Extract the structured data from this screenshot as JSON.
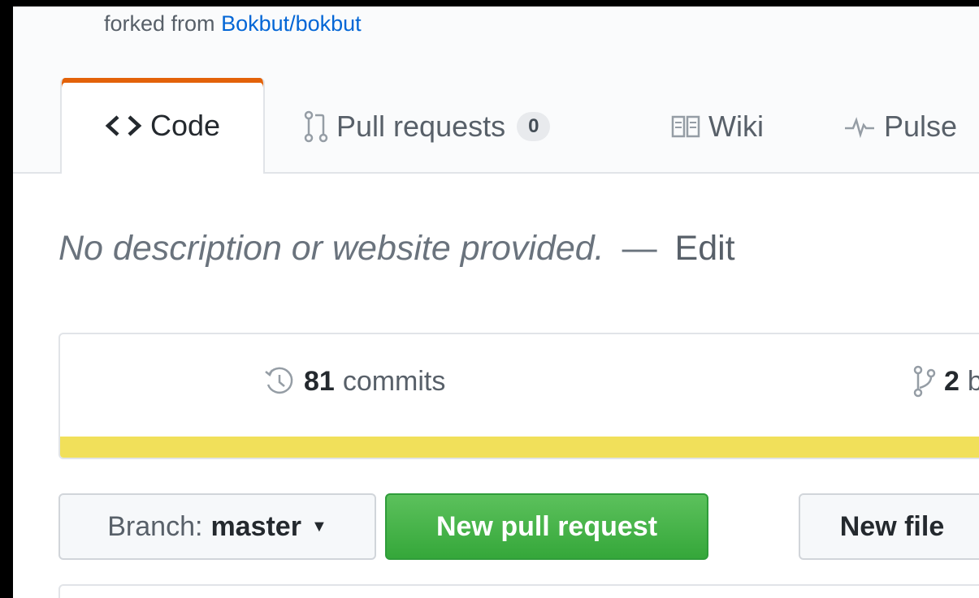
{
  "repo": {
    "fork_prefix": "forked from",
    "fork_source": "Bokbut/bokbut"
  },
  "tabs": [
    {
      "label": "Code",
      "icon": "code-icon",
      "selected": true
    },
    {
      "label": "Pull requests",
      "icon": "pull-request-icon",
      "count": "0"
    },
    {
      "label": "Wiki",
      "icon": "book-icon"
    },
    {
      "label": "Pulse",
      "icon": "pulse-icon"
    }
  ],
  "description": {
    "text": "No description or website provided.",
    "dash": "—",
    "edit_label": "Edit"
  },
  "summary": {
    "commits_count": "81",
    "commits_label": "commits",
    "branches_count": "2",
    "branches_label": "branches"
  },
  "actions": {
    "branch_prefix": "Branch:",
    "branch_name": "master",
    "new_pull_request": "New pull request",
    "new_file": "New file"
  },
  "colors": {
    "selected_tab_accent": "#e36209",
    "language_bar": "#f1e05a",
    "primary_button": "#3fb54a",
    "link": "#0366d6"
  }
}
